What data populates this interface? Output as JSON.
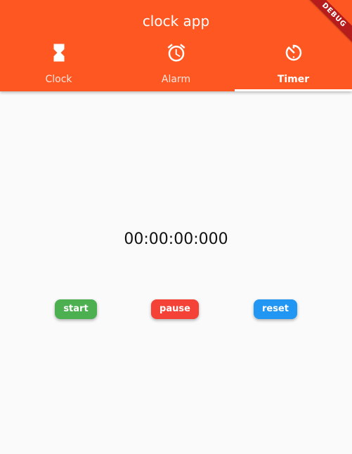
{
  "app": {
    "title": "clock app",
    "debug_banner": "DEBUG",
    "accent_color": "#ff5722"
  },
  "tabs": [
    {
      "label": "Clock",
      "icon": "hourglass-icon",
      "active": false
    },
    {
      "label": "Alarm",
      "icon": "alarm-clock-icon",
      "active": false
    },
    {
      "label": "Timer",
      "icon": "timer-icon",
      "active": true
    }
  ],
  "timer": {
    "display": "00:00:00:000"
  },
  "controls": {
    "start_label": "start",
    "pause_label": "pause",
    "reset_label": "reset",
    "start_color": "#4caf50",
    "pause_color": "#f44336",
    "reset_color": "#2196f3"
  }
}
